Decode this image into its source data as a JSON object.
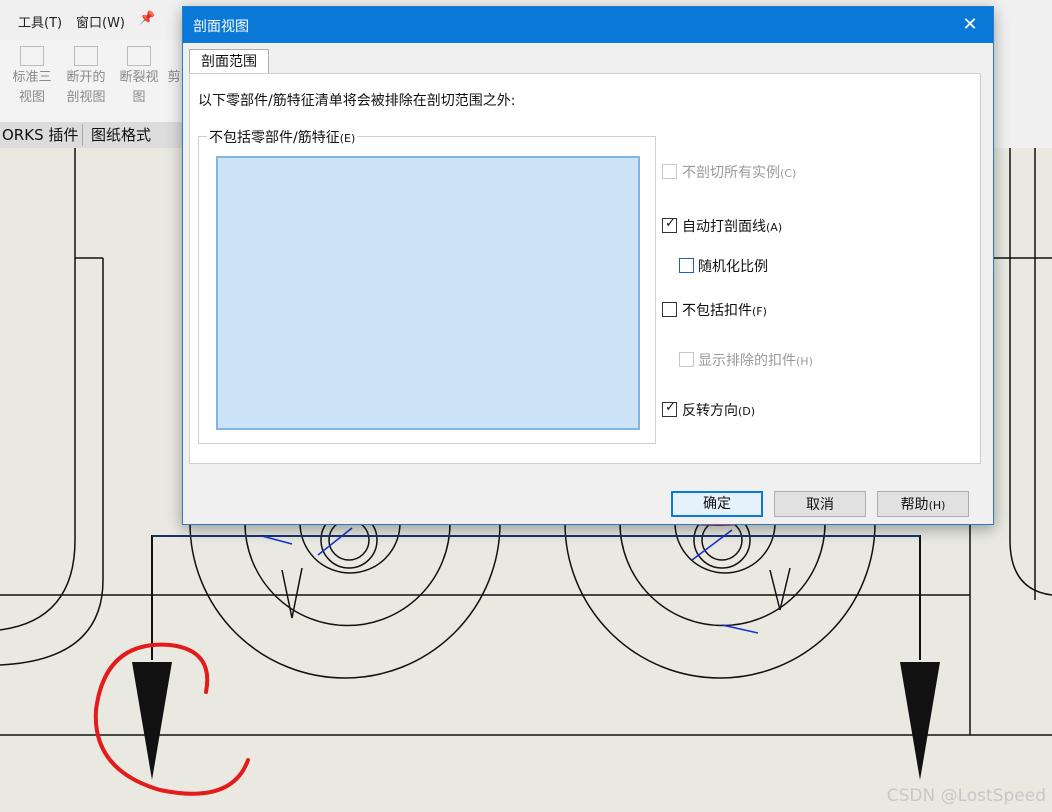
{
  "menubar": {
    "items": [
      "工具(T)",
      "窗口(W)"
    ],
    "pin_icon": "pin-icon"
  },
  "toolbar": {
    "buttons": [
      {
        "line1": "标准三",
        "line2": "视图"
      },
      {
        "line1": "断开的",
        "line2": "剖视图"
      },
      {
        "line1": "断裂视",
        "line2": "图"
      },
      {
        "line1": "剪",
        "line2": ""
      }
    ]
  },
  "cm_tabs": [
    "ORKS 插件",
    "图纸格式"
  ],
  "dialog": {
    "title": "剖面视图",
    "close_icon": "close-icon",
    "tab": "剖面范围",
    "description": "以下零部件/筋特征清单将会被排除在剖切范围之外:",
    "group_label": "不包括零部件/筋特征",
    "group_label_hotkey": "(E)",
    "options": [
      {
        "label": "不剖切所有实例",
        "hotkey": "(C)",
        "checked": false,
        "enabled": false
      },
      {
        "label": "自动打剖面线",
        "hotkey": "(A)",
        "checked": true,
        "enabled": true
      },
      {
        "label": "随机化比例",
        "hotkey": "",
        "checked": false,
        "enabled": true
      },
      {
        "label": "不包括扣件",
        "hotkey": "(F)",
        "checked": false,
        "enabled": true
      },
      {
        "label": "显示排除的扣件",
        "hotkey": "(H)",
        "checked": false,
        "enabled": false
      },
      {
        "label": "反转方向",
        "hotkey": "(D)",
        "checked": true,
        "enabled": true
      }
    ],
    "buttons": {
      "ok": "确定",
      "cancel": "取消",
      "help": "帮助",
      "help_hotkey": "(H)"
    }
  },
  "watermark": "CSDN @LostSpeed",
  "colors": {
    "titlebar": "#0a78d7",
    "list_fill": "#cce3f7",
    "annotation_red": "#e31b1b",
    "drawing_bg": "#e9e9e2"
  }
}
